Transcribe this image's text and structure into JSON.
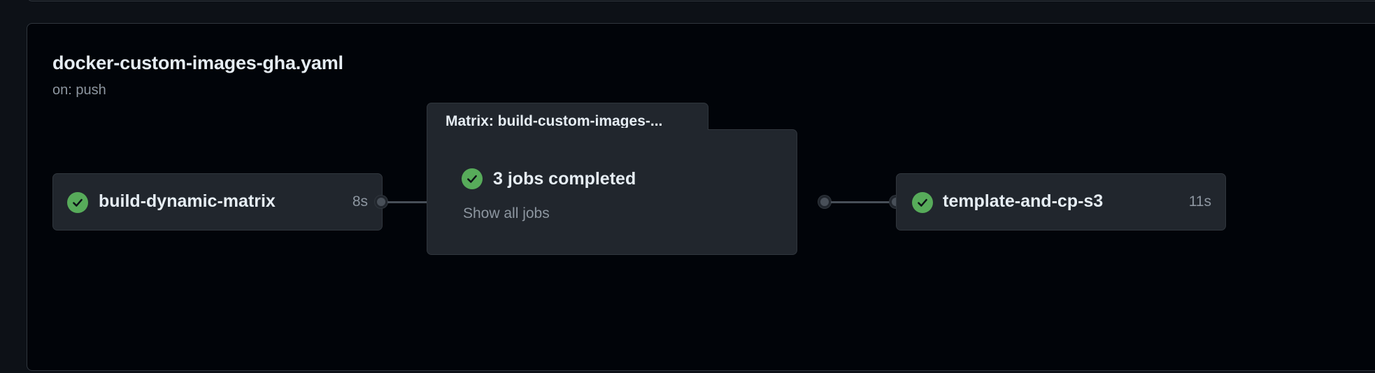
{
  "workflow": {
    "title": "docker-custom-images-gha.yaml",
    "trigger": "on: push"
  },
  "jobs": [
    {
      "name": "build-dynamic-matrix",
      "duration": "8s",
      "status": "success"
    },
    {
      "name": "template-and-cp-s3",
      "duration": "11s",
      "status": "success"
    }
  ],
  "matrix": {
    "label": "Matrix: build-custom-images-...",
    "summary": "3 jobs completed",
    "show_all": "Show all jobs",
    "status": "success"
  },
  "icons": {
    "success": "check-circle-icon"
  },
  "colors": {
    "success": "#57ab5a",
    "background": "#010409",
    "card": "#21262d",
    "border": "#30363d"
  }
}
